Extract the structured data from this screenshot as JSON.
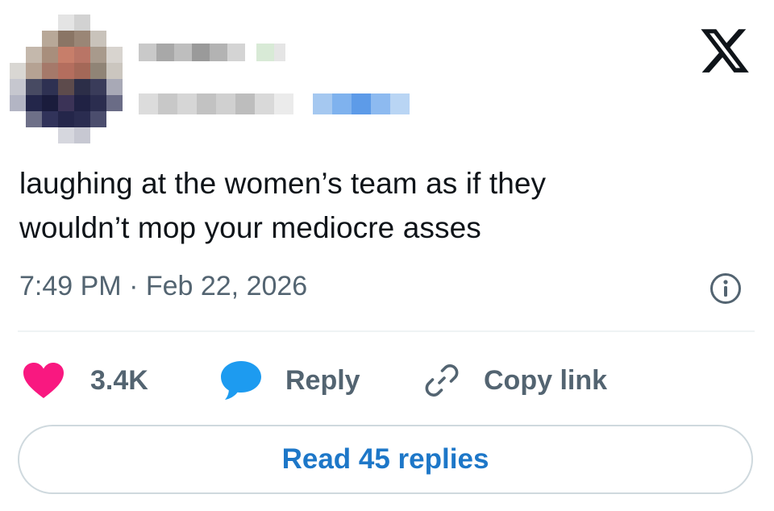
{
  "tweet": {
    "text_line1": "laughing at the women’s team as if they",
    "text_line2": "wouldn’t mop your mediocre asses",
    "timestamp": "7:49 PM · Feb 22, 2026"
  },
  "actions": {
    "like_count": "3.4K",
    "reply_label": "Reply",
    "copy_link_label": "Copy link"
  },
  "read_replies_label": "Read 45 replies",
  "icons": {
    "brand": "x-logo-icon",
    "info": "info-icon",
    "like": "heart-icon",
    "reply": "speech-bubble-icon",
    "copy": "link-icon"
  },
  "colors": {
    "like": "#f91880",
    "reply_bubble": "#1d9bf0",
    "read_replies_text": "#1d77c8",
    "secondary_text": "#536471",
    "divider": "#eff3f4"
  }
}
